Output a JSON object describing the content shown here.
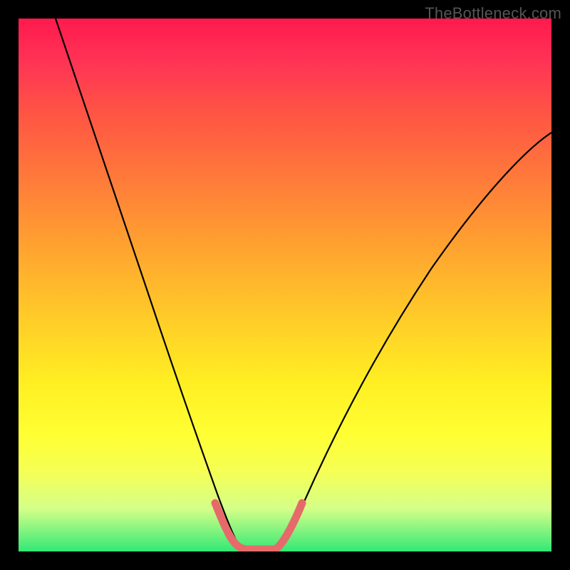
{
  "watermark": "TheBottleneck.com",
  "chart_data": {
    "type": "line",
    "title": "",
    "xlabel": "",
    "ylabel": "",
    "xlim": [
      0,
      100
    ],
    "ylim": [
      0,
      100
    ],
    "series": [
      {
        "name": "bottleneck-curve",
        "x": [
          7,
          12,
          18,
          24,
          30,
          34,
          37,
          39,
          41,
          43,
          45,
          47,
          49,
          52,
          56,
          62,
          70,
          80,
          90,
          100
        ],
        "y": [
          100,
          85,
          68,
          52,
          36,
          24,
          14,
          7,
          2,
          0,
          0,
          0,
          2,
          7,
          14,
          24,
          36,
          50,
          60,
          68
        ]
      },
      {
        "name": "optimal-zone-highlight",
        "x": [
          37,
          39,
          41,
          43,
          45,
          47,
          49
        ],
        "y": [
          7,
          3,
          1,
          1,
          1,
          3,
          7
        ]
      }
    ],
    "colors": {
      "curve": "#000000",
      "highlight": "#e66a6a",
      "gradient_top": "#ff1a4d",
      "gradient_bottom": "#33e876"
    }
  }
}
